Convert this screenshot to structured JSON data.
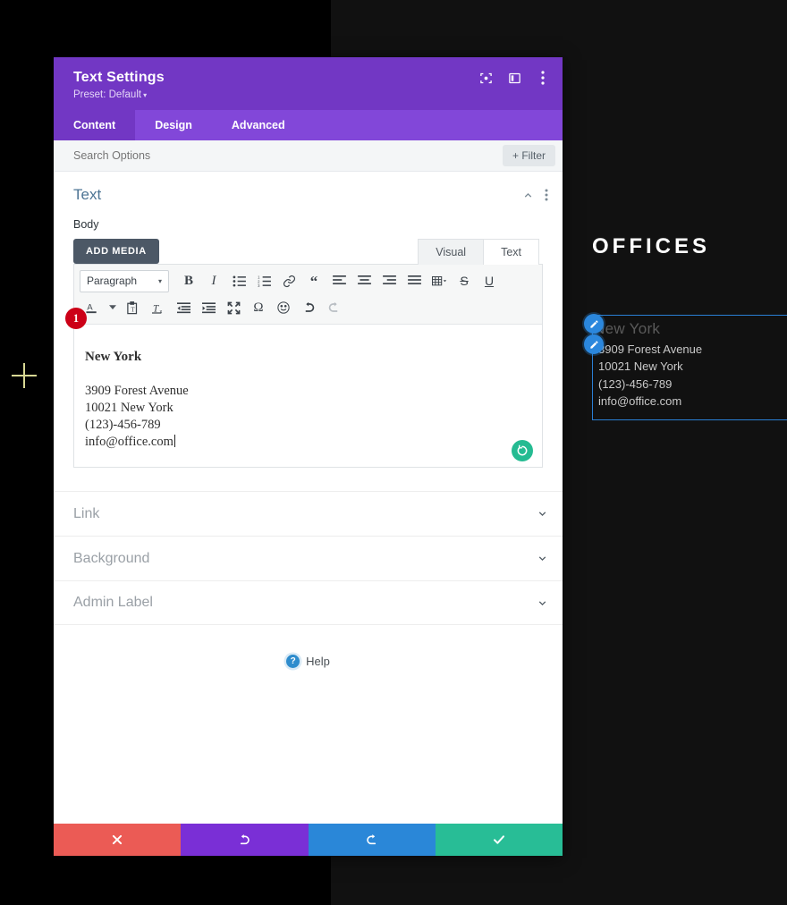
{
  "modal": {
    "title": "Text Settings",
    "preset": "Preset: Default",
    "preset_caret": "▾",
    "head_icons": [
      "focus-icon",
      "layout-panel-icon",
      "more-vertical-icon"
    ],
    "tabs": [
      {
        "label": "Content",
        "active": true
      },
      {
        "label": "Design",
        "active": false
      },
      {
        "label": "Advanced",
        "active": false
      }
    ],
    "search": {
      "placeholder": "Search Options",
      "value": ""
    },
    "filter_button": "+ Filter"
  },
  "section": {
    "title": "Text",
    "collapse_icon": "chevron-up-icon",
    "menu_icon": "more-vertical-icon",
    "field_label": "Body",
    "add_media": "ADD MEDIA",
    "editor_tabs": [
      {
        "label": "Visual",
        "active": true
      },
      {
        "label": "Text",
        "active": false
      }
    ]
  },
  "toolbar": {
    "format_select": "Paragraph",
    "select_caret": "▾",
    "row1": [
      "bold-icon",
      "italic-icon",
      "bulleted-list-icon",
      "numbered-list-icon",
      "link-icon",
      "blockquote-icon",
      "align-left-icon",
      "align-center-icon",
      "align-right-icon",
      "align-justify-icon",
      "table-icon",
      "strikethrough-icon",
      "underline-icon"
    ],
    "row2": [
      "text-color-icon",
      "paste-as-text-icon",
      "clear-formatting-icon",
      "decrease-indent-icon",
      "increase-indent-icon",
      "fullscreen-icon",
      "special-character-icon",
      "emoji-icon",
      "undo-icon",
      "redo-icon"
    ]
  },
  "editor": {
    "step_badge": "1",
    "city": "New York",
    "lines": [
      "3909 Forest Avenue",
      "10021 New York",
      "(123)-456-789",
      "info@office.com"
    ],
    "spinner_icon": "loading-spinner-icon"
  },
  "accordion": [
    {
      "label": "Link",
      "chevron": "chevron-down-icon"
    },
    {
      "label": "Background",
      "chevron": "chevron-down-icon"
    },
    {
      "label": "Admin Label",
      "chevron": "chevron-down-icon"
    }
  ],
  "help": {
    "icon_glyph": "?",
    "label": "Help"
  },
  "action_bar": [
    {
      "name": "cancel-button",
      "icon": "close-icon"
    },
    {
      "name": "undo-button",
      "icon": "undo-icon"
    },
    {
      "name": "redo-button",
      "icon": "redo-icon"
    },
    {
      "name": "save-button",
      "icon": "check-icon"
    }
  ],
  "preview": {
    "heading": "OFFICES",
    "city": "New York",
    "lines": [
      "3909 Forest Avenue",
      "10021 New York",
      "(123)-456-789",
      "info@office.com"
    ]
  },
  "colors": {
    "modal_header": "#7237c4",
    "tab_bar": "#8247d9",
    "accent_blue": "#2b87dd",
    "badge_red": "#cc0017",
    "save_teal": "#28bd96",
    "cancel_red": "#eb5b55",
    "redo_blue": "#2a87d8"
  }
}
